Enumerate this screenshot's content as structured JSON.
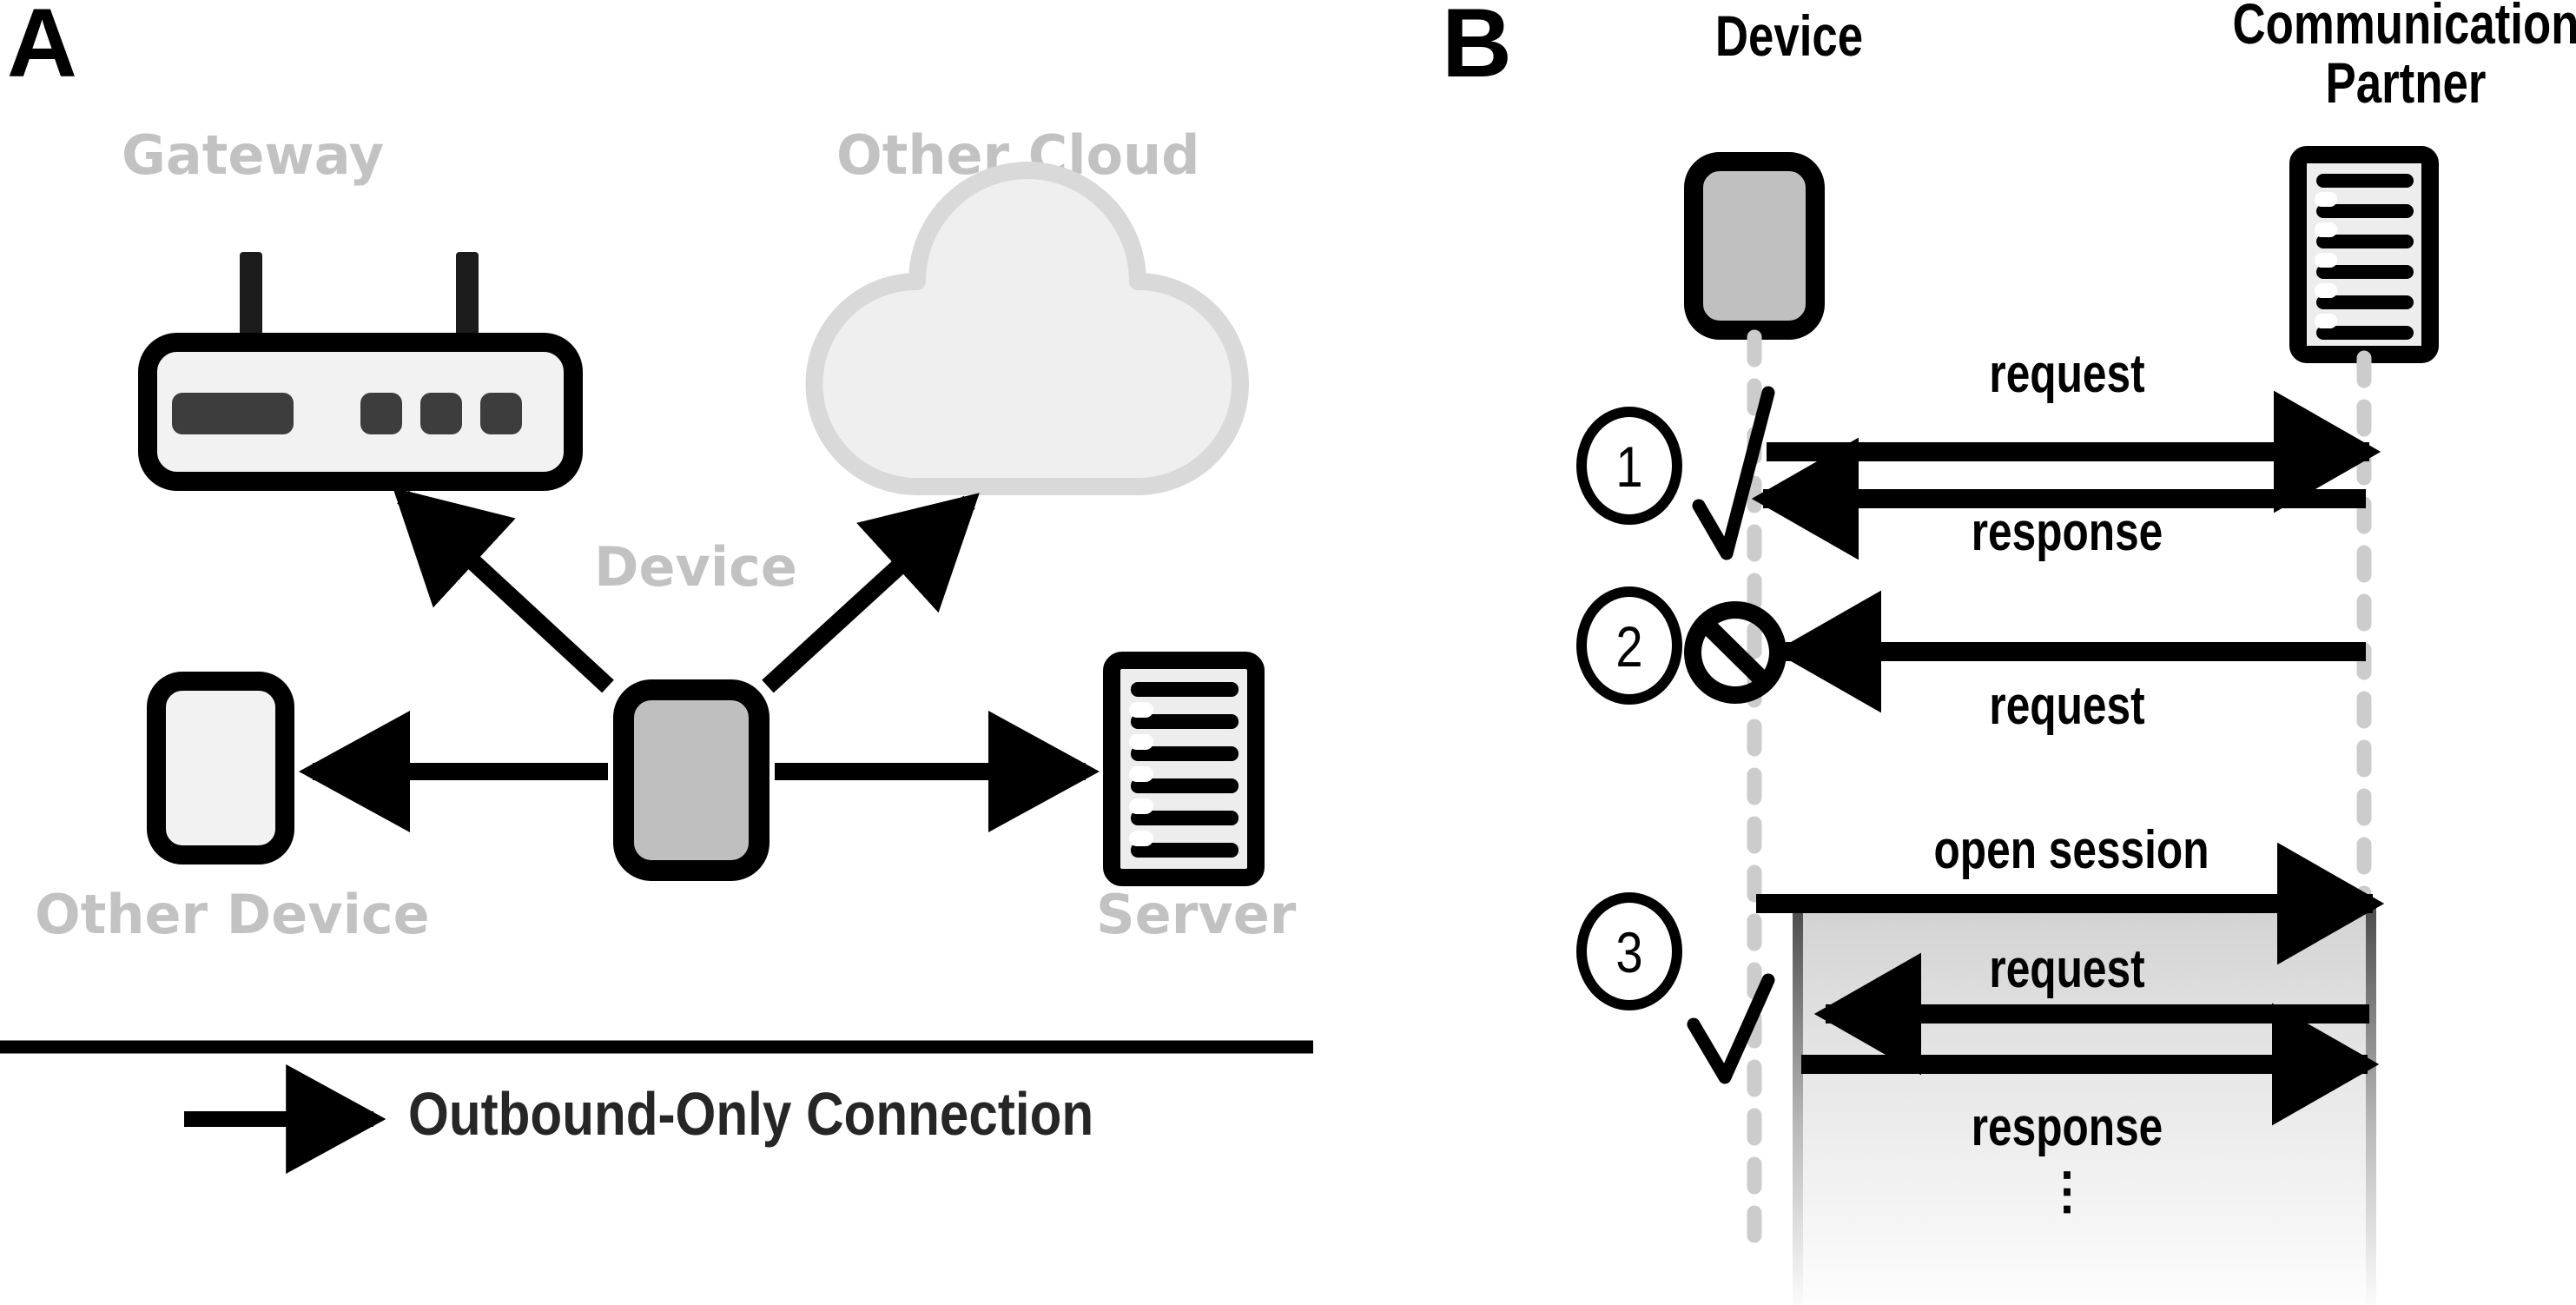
{
  "figure": {
    "panels": [
      {
        "letter": "A",
        "name": "outbound-only-connection-topology"
      },
      {
        "letter": "B",
        "name": "connection-sequence-scenarios"
      }
    ]
  },
  "panel_a": {
    "letter": "A",
    "nodes": [
      {
        "id": "gateway",
        "label": "Gateway",
        "icon": "router-icon",
        "label_color": "#c2c2c2"
      },
      {
        "id": "other-cloud",
        "label": "Other Cloud",
        "icon": "cloud-icon",
        "label_color": "#c2c2c2"
      },
      {
        "id": "device",
        "label": "Device",
        "icon": "device-icon",
        "label_color": "#c2c2c2"
      },
      {
        "id": "other-device",
        "label": "Other Device",
        "icon": "other-device-icon",
        "label_color": "#c2c2c2"
      },
      {
        "id": "server",
        "label": "Server",
        "icon": "server-icon",
        "label_color": "#c2c2c2"
      }
    ],
    "connections": [
      {
        "from": "device",
        "to": "gateway",
        "direction": "outbound"
      },
      {
        "from": "device",
        "to": "other-cloud",
        "direction": "outbound"
      },
      {
        "from": "device",
        "to": "other-device",
        "direction": "outbound"
      },
      {
        "from": "device",
        "to": "server",
        "direction": "outbound"
      }
    ],
    "legend": {
      "arrow_icon": "arrow-right-icon",
      "label": "Outbound-Only Connection"
    }
  },
  "panel_b": {
    "letter": "B",
    "lifelines": [
      {
        "id": "device",
        "label": "Device",
        "icon": "device-icon"
      },
      {
        "id": "communication-partner",
        "label": "Communication Partner",
        "label_line1": "Communication",
        "label_line2": "Partner",
        "icon": "server-icon"
      }
    ],
    "steps": [
      {
        "number": "1",
        "status_icon": "check-icon",
        "status": "allowed",
        "messages": [
          {
            "label": "request",
            "direction": "device-to-partner"
          },
          {
            "label": "response",
            "direction": "partner-to-device"
          }
        ]
      },
      {
        "number": "2",
        "status_icon": "blocked-icon",
        "status": "blocked",
        "messages": [
          {
            "label": "request",
            "direction": "partner-to-device"
          }
        ]
      },
      {
        "number": "3",
        "status_icon": "check-icon",
        "status": "allowed",
        "session_box": true,
        "continuation": "⋮",
        "messages": [
          {
            "label": "open session",
            "direction": "device-to-partner"
          },
          {
            "label": "request",
            "direction": "partner-to-device"
          },
          {
            "label": "response",
            "direction": "device-to-partner"
          }
        ]
      }
    ]
  },
  "colors": {
    "stroke": "#000000",
    "label_gray": "#c2c2c2",
    "device_fill": "#c0c0c0",
    "light_fill": "#f0f0f0",
    "cloud_fill": "#efefef",
    "cloud_stroke": "#d8d8d8",
    "lifeline": "#cccccc",
    "legend_text": "#262626"
  }
}
